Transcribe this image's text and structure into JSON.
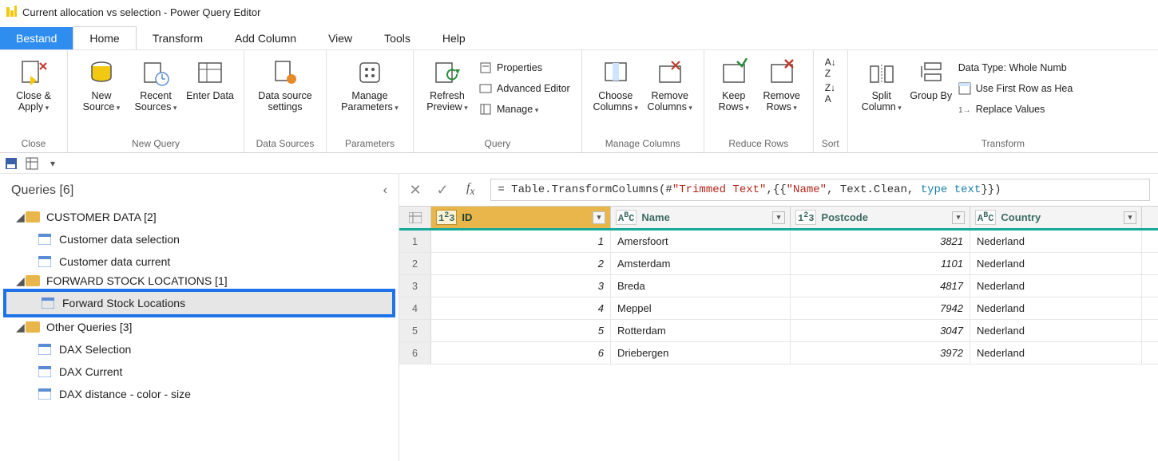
{
  "window": {
    "title": "Current allocation vs selection - Power Query Editor"
  },
  "tabs": {
    "file": "Bestand",
    "items": [
      "Home",
      "Transform",
      "Add Column",
      "View",
      "Tools",
      "Help"
    ],
    "active": "Home"
  },
  "ribbon": {
    "groups": {
      "close": {
        "caption": "Close",
        "close_apply": "Close & Apply"
      },
      "newquery": {
        "caption": "New Query",
        "new_source": "New Source",
        "recent_sources": "Recent Sources",
        "enter_data": "Enter Data"
      },
      "datasources": {
        "caption": "Data Sources",
        "settings": "Data source settings"
      },
      "parameters": {
        "caption": "Parameters",
        "manage_params": "Manage Parameters"
      },
      "query": {
        "caption": "Query",
        "refresh": "Refresh Preview",
        "properties": "Properties",
        "advanced": "Advanced Editor",
        "manage": "Manage"
      },
      "managecols": {
        "caption": "Manage Columns",
        "choose": "Choose Columns",
        "remove": "Remove Columns"
      },
      "reducerows": {
        "caption": "Reduce Rows",
        "keep": "Keep Rows",
        "removerows": "Remove Rows"
      },
      "sort": {
        "caption": "Sort"
      },
      "transform": {
        "caption": "Transform",
        "split": "Split Column",
        "groupby": "Group By",
        "datatype": "Data Type: Whole Numb",
        "firstrow": "Use First Row as Hea",
        "replace": "Replace Values"
      }
    }
  },
  "queries_panel": {
    "header": "Queries [6]",
    "folders": [
      {
        "name": "CUSTOMER DATA [2]",
        "items": [
          "Customer data selection",
          "Customer data current"
        ]
      },
      {
        "name": "FORWARD STOCK LOCATIONS [1]",
        "items": [
          "Forward Stock Locations"
        ],
        "selected_item": "Forward Stock Locations"
      },
      {
        "name": "Other Queries [3]",
        "items": [
          "DAX Selection",
          "DAX Current",
          "DAX distance - color - size"
        ]
      }
    ]
  },
  "formula": {
    "prefix": "= Table.TransformColumns(#",
    "str1": "\"Trimmed Text\"",
    "mid1": ",{{",
    "str2": "\"Name\"",
    "mid2": ", Text.Clean, ",
    "kw": "type text",
    "suffix": "}})"
  },
  "grid": {
    "columns": [
      {
        "key": "id",
        "label": "ID",
        "type": "123"
      },
      {
        "key": "name",
        "label": "Name",
        "type": "ABC"
      },
      {
        "key": "postcode",
        "label": "Postcode",
        "type": "123"
      },
      {
        "key": "country",
        "label": "Country",
        "type": "ABC"
      }
    ],
    "rows": [
      {
        "n": "1",
        "id": "1",
        "name": "Amersfoort",
        "postcode": "3821",
        "country": "Nederland"
      },
      {
        "n": "2",
        "id": "2",
        "name": "Amsterdam",
        "postcode": "1101",
        "country": "Nederland"
      },
      {
        "n": "3",
        "id": "3",
        "name": "Breda",
        "postcode": "4817",
        "country": "Nederland"
      },
      {
        "n": "4",
        "id": "4",
        "name": "Meppel",
        "postcode": "7942",
        "country": "Nederland"
      },
      {
        "n": "5",
        "id": "5",
        "name": "Rotterdam",
        "postcode": "3047",
        "country": "Nederland"
      },
      {
        "n": "6",
        "id": "6",
        "name": "Driebergen",
        "postcode": "3972",
        "country": "Nederland"
      }
    ]
  }
}
